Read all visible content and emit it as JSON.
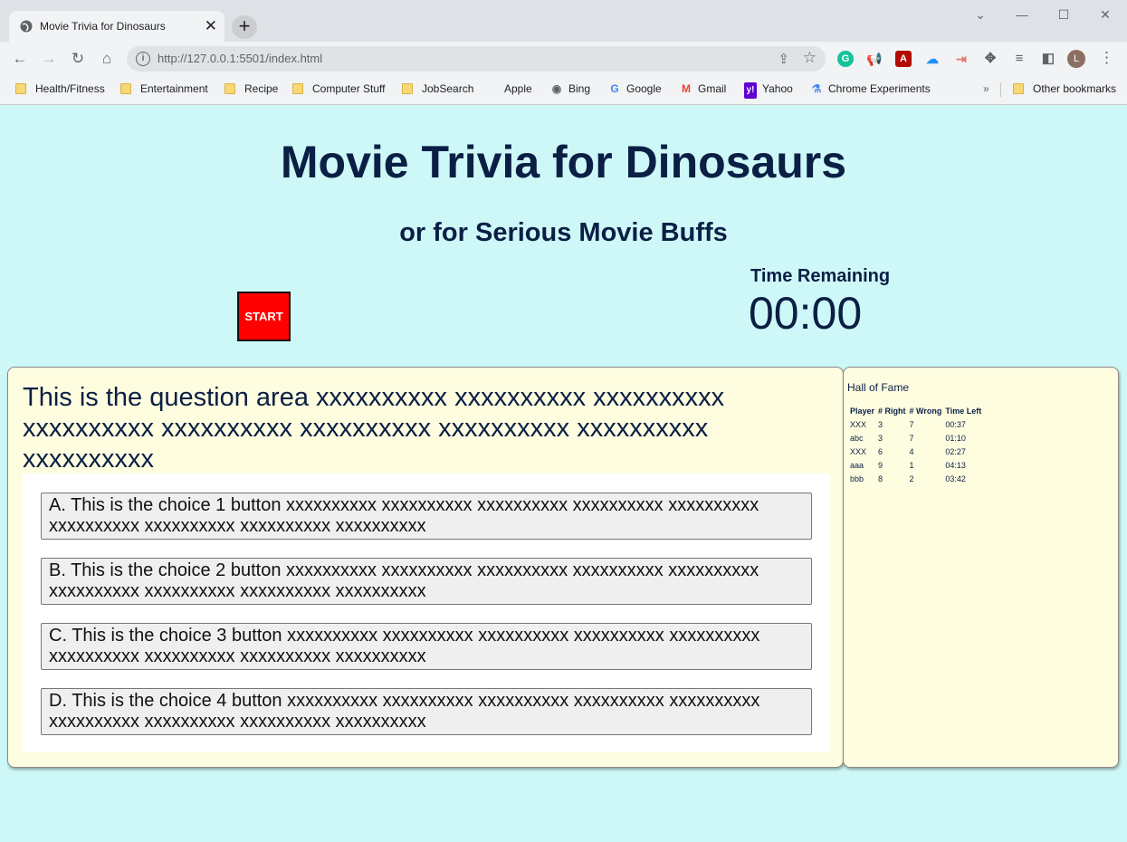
{
  "browser": {
    "tab_title": "Movie Trivia for Dinosaurs",
    "url": "http://127.0.0.1:5501/index.html",
    "profile_initial": "L",
    "bookmarks": [
      {
        "label": "Health/Fitness",
        "icon": "folder-icon"
      },
      {
        "label": "Entertainment",
        "icon": "folder-icon"
      },
      {
        "label": "Recipe",
        "icon": "folder-icon"
      },
      {
        "label": "Computer Stuff",
        "icon": "folder-icon"
      },
      {
        "label": "JobSearch",
        "icon": "folder-icon"
      },
      {
        "label": "Apple",
        "icon": "apple-icon"
      },
      {
        "label": "Bing",
        "icon": "globe-icon"
      },
      {
        "label": "Google",
        "icon": "google-icon"
      },
      {
        "label": "Gmail",
        "icon": "gmail-icon"
      },
      {
        "label": "Yahoo",
        "icon": "yahoo-icon"
      },
      {
        "label": "Chrome Experiments",
        "icon": "flask-icon"
      }
    ],
    "other_bookmarks": "Other bookmarks"
  },
  "page": {
    "title": "Movie Trivia for Dinosaurs",
    "subtitle": "or for Serious Movie Buffs",
    "start_label": "START",
    "timer_label": "Time Remaining",
    "timer_value": "00:00",
    "background_color": "#cef8f8",
    "accent_color": "#ff0000"
  },
  "quiz": {
    "question": "This is the question area xxxxxxxxxx xxxxxxxxxx xxxxxxxxxx xxxxxxxxxx xxxxxxxxxx xxxxxxxxxx xxxxxxxxxx xxxxxxxxxx xxxxxxxxxx",
    "choices": [
      "A. This is the choice 1 button xxxxxxxxxx xxxxxxxxxx xxxxxxxxxx xxxxxxxxxx xxxxxxxxxx xxxxxxxxxx xxxxxxxxxx xxxxxxxxxx xxxxxxxxxx",
      "B. This is the choice 2 button xxxxxxxxxx xxxxxxxxxx xxxxxxxxxx xxxxxxxxxx xxxxxxxxxx xxxxxxxxxx xxxxxxxxxx xxxxxxxxxx xxxxxxxxxx",
      "C. This is the choice 3 button xxxxxxxxxx xxxxxxxxxx xxxxxxxxxx xxxxxxxxxx xxxxxxxxxx xxxxxxxxxx xxxxxxxxxx xxxxxxxxxx xxxxxxxxxx",
      "D. This is the choice 4 button xxxxxxxxxx xxxxxxxxxx xxxxxxxxxx xxxxxxxxxx xxxxxxxxxx xxxxxxxxxx xxxxxxxxxx xxxxxxxxxx xxxxxxxxxx"
    ]
  },
  "hall_of_fame": {
    "title": "Hall of Fame",
    "columns": [
      "Player",
      "# Right",
      "# Wrong",
      "Time Left"
    ],
    "rows": [
      [
        "XXX",
        "3",
        "7",
        "00:37"
      ],
      [
        "abc",
        "3",
        "7",
        "01:10"
      ],
      [
        "XXX",
        "6",
        "4",
        "02:27"
      ],
      [
        "aaa",
        "9",
        "1",
        "04:13"
      ],
      [
        "bbb",
        "8",
        "2",
        "03:42"
      ]
    ]
  }
}
